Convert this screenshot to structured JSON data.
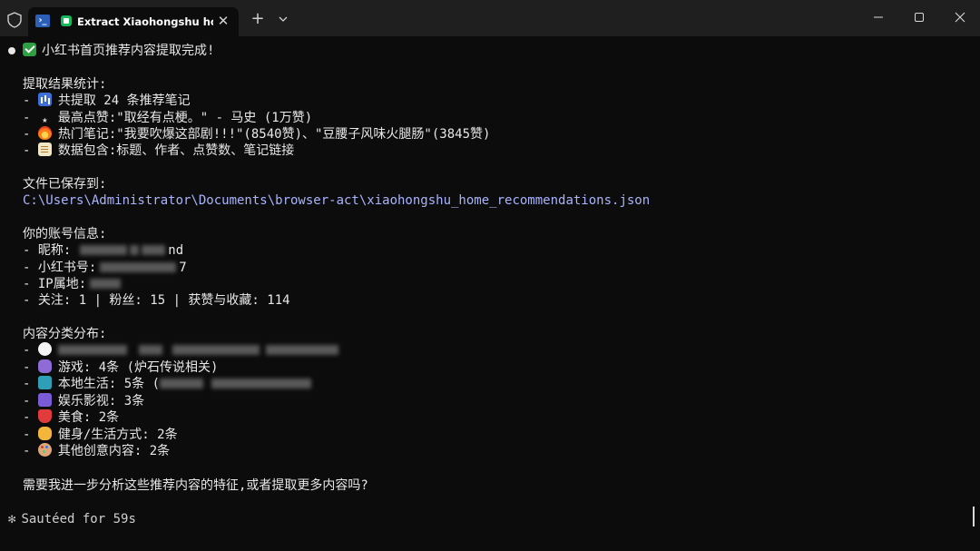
{
  "window": {
    "tab_title": "Extract Xiaohongshu home",
    "tab_close": "✕",
    "new_tab": "+",
    "dropdown": "⌄",
    "minimize": "—",
    "maximize": "☐",
    "close": "✕"
  },
  "terminal": {
    "headline": "小红书首页推荐内容提取完成!",
    "stats_title": "提取结果统计:",
    "stats": [
      {
        "icon": "bar-chart-icon",
        "text": "共提取 24 条推荐笔记"
      },
      {
        "icon": "star-icon",
        "text": "最高点赞:\"取经有点梗。\" - 马史 (1万赞)"
      },
      {
        "icon": "fire-icon",
        "text": "热门笔记:\"我要吹爆这部剧!!!\"(8540赞)、\"豆腰子风味火腿肠\"(3845赞)"
      },
      {
        "icon": "memo-icon",
        "text": "数据包含:标题、作者、点赞数、笔记链接"
      }
    ],
    "saved_title": "文件已保存到:",
    "saved_path": "C:\\Users\\Administrator\\Documents\\browser-act\\xiaohongshu_home_recommendations.json",
    "account_title": "你的账号信息:",
    "account": {
      "nickname_label": "- 昵称:",
      "nickname_visible": "nd",
      "id_label": "- 小红书号:",
      "id_visible": "7",
      "ip_label": "- IP属地:",
      "follow_line": "- 关注: 1 | 粉丝: 15 | 获赞与收藏: 114"
    },
    "category_title": "内容分类分布:",
    "categories": [
      {
        "icon": "speech-bubble-icon",
        "text": ""
      },
      {
        "icon": "game-controller-icon",
        "text": "游戏: 4条 (炉石传说相关)"
      },
      {
        "icon": "book-icon",
        "text": "本地生活: 5条 ("
      },
      {
        "icon": "clapper-board-icon",
        "text": "娱乐影视: 3条"
      },
      {
        "icon": "noodles-icon",
        "text": "美食: 2条"
      },
      {
        "icon": "flexed-biceps-icon",
        "text": "健身/生活方式: 2条"
      },
      {
        "icon": "palette-icon",
        "text": "其他创意内容: 2条"
      }
    ],
    "question": "需要我进一步分析这些推荐内容的特征,或者提取更多内容吗?",
    "status_spinner": "✻",
    "status_text": "Sautéed for 59s"
  },
  "colors": {
    "background": "#0c0c0c",
    "titlebar": "#1f1f1f",
    "text": "#e8e8e8",
    "path": "#a9b4ff",
    "check": "#2ea043"
  }
}
